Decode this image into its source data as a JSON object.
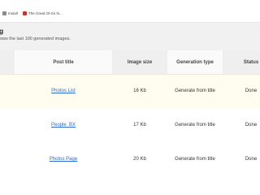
{
  "bookmarks": [
    {
      "label": "Install"
    },
    {
      "label": "The Great Ol-Gs hi..."
    }
  ],
  "page": {
    "title": "g",
    "description": "ows the last 100 generated images."
  },
  "table": {
    "headers": {
      "post_title": "Post title",
      "image_size": "Image size",
      "generation_type": "Generation type",
      "status": "Status"
    },
    "rows": [
      {
        "post_title": "Photos List",
        "image_size": "16 Kb",
        "generation_type": "Generate from title",
        "status": "Done"
      },
      {
        "post_title": "People_BX",
        "image_size": "17 Kb",
        "generation_type": "Generate from title",
        "status": "Done"
      },
      {
        "post_title": "Photos Page",
        "image_size": "20 Kb",
        "generation_type": "Generate from title",
        "status": "Done"
      }
    ]
  },
  "colors": {
    "link": "#2a6ad1",
    "header_band": "#f1f1f1",
    "highlight_row": "#fffdf0"
  }
}
